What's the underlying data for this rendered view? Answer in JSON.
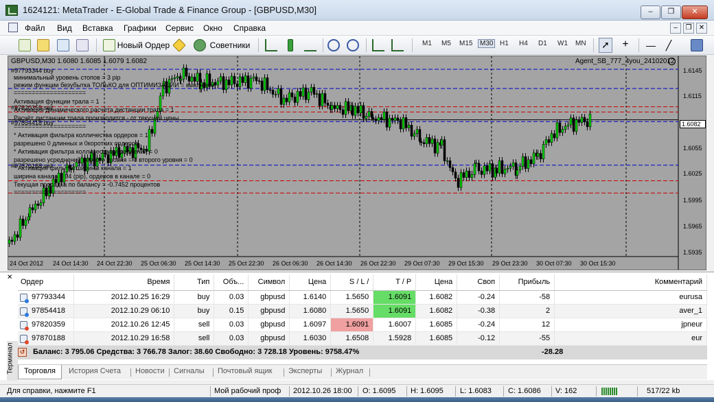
{
  "window": {
    "title": "1624121: MetaTrader - E-Global Trade & Finance Group - [GBPUSD,M30]",
    "min_glyph": "–",
    "max_glyph": "❐",
    "close_glyph": "✕"
  },
  "menu": {
    "items": [
      "Файл",
      "Вид",
      "Вставка",
      "Графики",
      "Сервис",
      "Окно",
      "Справка"
    ],
    "mdi_min": "–",
    "mdi_restore": "❐",
    "mdi_close": "✕"
  },
  "toolbar": {
    "new_order": "Новый Ордер",
    "experts": "Советники",
    "timeframes": [
      "M1",
      "M5",
      "M15",
      "M30",
      "H1",
      "H4",
      "D1",
      "W1",
      "MN"
    ],
    "active_timeframe": "M30"
  },
  "chart": {
    "info": "GBPUSD,M30  1.6080 1.6085 1.6079 1.6082",
    "ea_name": "Agent_SB_777_4you_24102012",
    "comment_lines": [
      "минимальный уровень стопов = 3  pip",
      "режим функции безубытка ТОЛЬКО для ОПТИМИЗАЦИИ = выключен",
      "====================",
      " Активация функции трала = 1",
      " Активация динамического расчёта дистанции трала = 1",
      "Расчёт дистанции трала производится - от текущей цены",
      "====================",
      "* Активация фильтра колличества ордеров = 1",
      "разрешено 0 длинных и 0коротких ордеров",
      " * Активация фильтра колличества усреднений = 0",
      "разрешено усреднений первого уровня = 0 второго уровня = 0",
      " * Активация фильтра ширины канала = 1",
      "ширина канала = 94 (pip), ордеров в канале = 0",
      "Текущая просадка по балансу = -0.7452 процентов",
      "===================="
    ],
    "order_labels": [
      "#97793344 buy",
      "#97820359 sell",
      "#97854418 buy",
      "#97870188 sell"
    ],
    "current_price": "1.6082",
    "price_ticks": [
      "1.6145",
      "1.6115",
      "1.6055",
      "1.6025",
      "1.5995",
      "1.5965",
      "1.5935"
    ],
    "time_ticks": [
      "24 Oct 2012",
      "24 Oct 14:30",
      "24 Oct 22:30",
      "25 Oct 06:30",
      "25 Oct 14:30",
      "25 Oct 22:30",
      "26 Oct 06:30",
      "26 Oct 14:30",
      "26 Oct 22:30",
      "29 Oct 07:30",
      "29 Oct 15:30",
      "29 Oct 23:30",
      "30 Oct 07:30",
      "30 Oct 15:30"
    ],
    "colors": {
      "background": "#a4a4a4",
      "bull": "#00cc00",
      "bear": "#000000",
      "buy_line": "#0000cc",
      "sell_line": "#cc0000"
    }
  },
  "terminal": {
    "close_glyph": "✕",
    "sidebar_label": "Терминал",
    "headers": [
      "Ордер",
      "Время",
      "Тип",
      "Объ...",
      "Символ",
      "Цена",
      "S / L  /",
      "T / P",
      "Цена",
      "Своп",
      "Прибыль",
      "Комментарий"
    ],
    "orders": [
      {
        "ticket": "97793344",
        "time": "2012.10.25 16:29",
        "type": "buy",
        "volume": "0.03",
        "symbol": "gbpusd",
        "price": "1.6140",
        "sl": "1.5650",
        "tp": "1.6091",
        "cur_price": "1.6082",
        "swap": "-0.24",
        "profit": "-58",
        "comment": "eurusa"
      },
      {
        "ticket": "97854418",
        "time": "2012.10.29 06:10",
        "type": "buy",
        "volume": "0.15",
        "symbol": "gbpusd",
        "price": "1.6080",
        "sl": "1.5650",
        "tp": "1.6091",
        "cur_price": "1.6082",
        "swap": "-0.38",
        "profit": "2",
        "comment": "aver_1"
      },
      {
        "ticket": "97820359",
        "time": "2012.10.26 12:45",
        "type": "sell",
        "volume": "0.03",
        "symbol": "gbpusd",
        "price": "1.6097",
        "sl": "1.6091",
        "tp": "1.6007",
        "cur_price": "1.6085",
        "swap": "-0.24",
        "profit": "12",
        "comment": "jpneur"
      },
      {
        "ticket": "97870188",
        "time": "2012.10.29 16:58",
        "type": "sell",
        "volume": "0.03",
        "symbol": "gbpusd",
        "price": "1.6030",
        "sl": "1.6508",
        "tp": "1.5928",
        "cur_price": "1.6085",
        "swap": "-0.12",
        "profit": "-55",
        "comment": "eur"
      }
    ],
    "balance": "Баланс: 3 795.06  Средства: 3 766.78  Залог: 38.60  Свободно: 3 728.18  Уровень: 9758.47%",
    "total_profit": "-28.28",
    "tabs": [
      "Торговля",
      "История Счета",
      "Новости",
      "Сигналы",
      "Почтовый ящик",
      "Эксперты",
      "Журнал"
    ]
  },
  "status": {
    "help": "Для справки, нажмите F1",
    "profile": "Мой рабочий проф",
    "datetime": "2012.10.26 18:00",
    "open": "O: 1.6095",
    "high": "H: 1.6095",
    "low": "L: 1.6083",
    "close": "C: 1.6086",
    "volume": "V: 162",
    "traffic": "517/22 kb"
  }
}
